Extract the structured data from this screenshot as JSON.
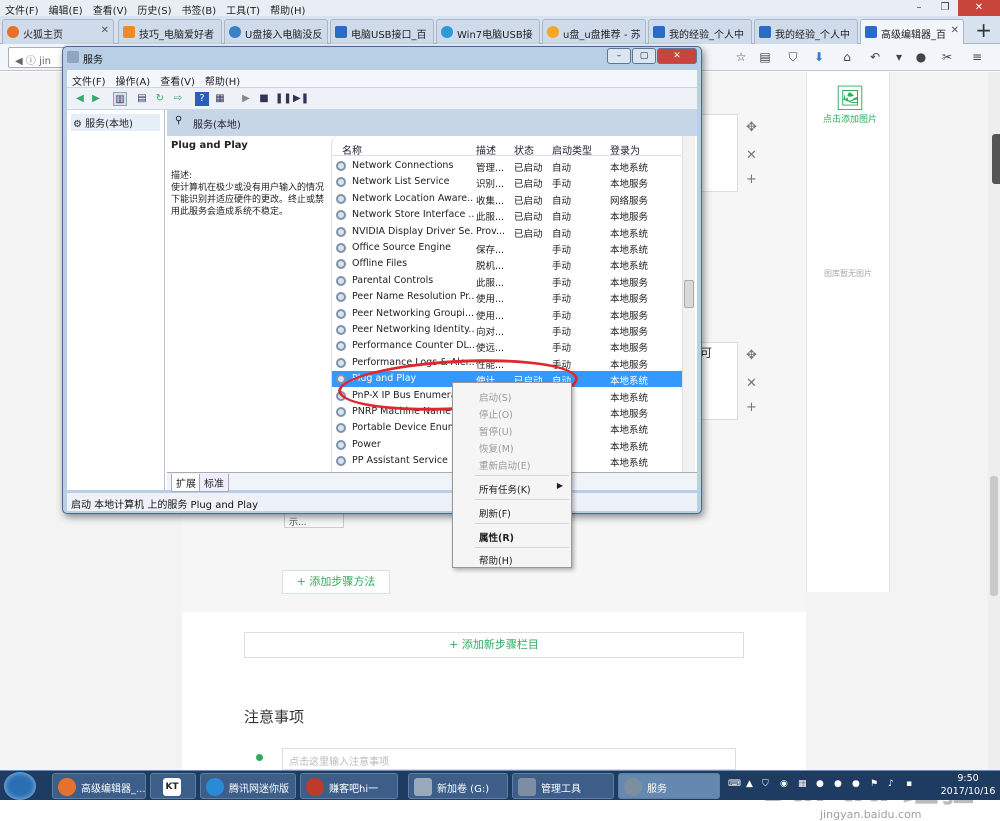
{
  "browser": {
    "menu": [
      "文件(F)",
      "编辑(E)",
      "查看(V)",
      "历史(S)",
      "书签(B)",
      "工具(T)",
      "帮助(H)"
    ],
    "tabs": [
      {
        "label": "火狐主页",
        "color": "#e8712a"
      },
      {
        "label": "技巧_电脑爱好者",
        "color": "#f08a24"
      },
      {
        "label": "U盘接入电脑没反",
        "color": "#3a7fc8"
      },
      {
        "label": "电脑USB接口_百",
        "color": "#2a6cc4"
      },
      {
        "label": "Win7电脑USB接",
        "color": "#2b9ad6"
      },
      {
        "label": "u盘_u盘推荐 - 苏",
        "color": "#f5a623"
      },
      {
        "label": "我的经验_个人中",
        "color": "#2a6cc4"
      },
      {
        "label": "我的经验_个人中",
        "color": "#2a6cc4"
      },
      {
        "label": "高级编辑器_百",
        "color": "#2a6cc4"
      }
    ],
    "url": "jin"
  },
  "page": {
    "add_image": "点击添加图片",
    "no_image": "图库暂无图片",
    "add_step_method": "+ 添加步骤方法",
    "add_step_section": "+ 添加新步骤栏目",
    "notes_title": "注意事项",
    "notes_placeholder": "点击这里输入注意事项",
    "side_text": "可",
    "pill_text": "示...",
    "watermark": "Bai du 经验",
    "watermark_sub": "jingyan.baidu.com"
  },
  "services": {
    "title": "服务",
    "menu": [
      "文件(F)",
      "操作(A)",
      "查看(V)",
      "帮助(H)"
    ],
    "tree_item": "服务(本地)",
    "header": "服务(本地)",
    "selected_name": "Plug and Play",
    "desc_label": "描述:",
    "desc_text": "使计算机在极少或没有用户输入的情况下能识别并适应硬件的更改。终止或禁用此服务会造成系统不稳定。",
    "columns": [
      "名称",
      "描述",
      "状态",
      "启动类型",
      "登录为"
    ],
    "rows": [
      [
        "Network Connections",
        "管理...",
        "已启动",
        "自动",
        "本地系统"
      ],
      [
        "Network List Service",
        "识别...",
        "已启动",
        "手动",
        "本地服务"
      ],
      [
        "Network Location Aware...",
        "收集...",
        "已启动",
        "自动",
        "网络服务"
      ],
      [
        "Network Store Interface ...",
        "此服...",
        "已启动",
        "自动",
        "本地服务"
      ],
      [
        "NVIDIA Display Driver Se...",
        "Prov...",
        "已启动",
        "自动",
        "本地系统"
      ],
      [
        "Office Source Engine",
        "保存...",
        "",
        "手动",
        "本地系统"
      ],
      [
        "Offline Files",
        "脱机...",
        "",
        "手动",
        "本地系统"
      ],
      [
        "Parental Controls",
        "此服...",
        "",
        "手动",
        "本地服务"
      ],
      [
        "Peer Name Resolution Pr...",
        "使用...",
        "",
        "手动",
        "本地服务"
      ],
      [
        "Peer Networking Groupi...",
        "使用...",
        "",
        "手动",
        "本地服务"
      ],
      [
        "Peer Networking Identity...",
        "向对...",
        "",
        "手动",
        "本地服务"
      ],
      [
        "Performance Counter DL...",
        "使远...",
        "",
        "手动",
        "本地服务"
      ],
      [
        "Performance Logs & Aler...",
        "性能...",
        "",
        "手动",
        "本地服务"
      ],
      [
        "Plug and Play",
        "使计...",
        "已启动",
        "自动",
        "本地系统"
      ],
      [
        "PnP-X IP Bus Enumerator",
        "",
        "",
        "",
        "本地系统"
      ],
      [
        "PNRP Machine Name",
        "",
        "",
        "",
        "本地服务"
      ],
      [
        "Portable Device Enume...",
        "",
        "",
        "",
        "本地系统"
      ],
      [
        "Power",
        "",
        "",
        "",
        "本地系统"
      ],
      [
        "PP Assistant Service",
        "",
        "",
        "",
        "本地系统"
      ]
    ],
    "selected_row": 13,
    "bottom_tabs": [
      "扩展",
      "标准"
    ],
    "status": "启动 本地计算机 上的服务 Plug and Play"
  },
  "context_menu": {
    "items": [
      {
        "label": "启动(S)",
        "disabled": true
      },
      {
        "label": "停止(O)",
        "disabled": true
      },
      {
        "label": "暂停(U)",
        "disabled": true
      },
      {
        "label": "恢复(M)",
        "disabled": true
      },
      {
        "label": "重新启动(E)",
        "disabled": true
      },
      {
        "label": "所有任务(K)",
        "submenu": true
      },
      {
        "label": "刷新(F)"
      },
      {
        "label": "属性(R)",
        "bold": true
      },
      {
        "label": "帮助(H)"
      }
    ]
  },
  "taskbar": {
    "items": [
      {
        "label": "高级编辑器_...",
        "color": "#e8712a"
      },
      {
        "label": "",
        "color": "#222"
      },
      {
        "label": "腾讯网迷你版",
        "color": "#2a8ad6"
      },
      {
        "label": "赚客吧hi一",
        "color": "#c0392b"
      },
      {
        "label": "新加卷 (G:)",
        "color": "#9aa9b9"
      },
      {
        "label": "管理工具",
        "color": "#7d8ea3"
      },
      {
        "label": "服务",
        "color": "#7d8ea3"
      }
    ],
    "time": "9:50",
    "date": "2017/10/16"
  },
  "colors": {
    "accent_green": "#2dad5d",
    "selection_blue": "#3399ff",
    "highlight_red": "#e0262e"
  }
}
